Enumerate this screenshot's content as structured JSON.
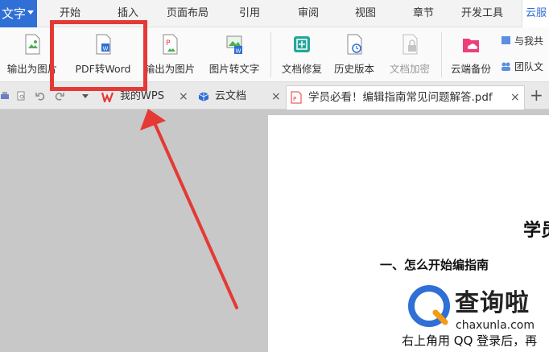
{
  "menubar": {
    "app_label": "文字",
    "tabs": [
      "开始",
      "插入",
      "页面布局",
      "引用",
      "审阅",
      "视图",
      "章节",
      "开发工具",
      "云服"
    ]
  },
  "ribbon": {
    "buttons": [
      "输出为图片",
      "PDF转Word",
      "输出为图片",
      "图片转文字",
      "文档修复",
      "历史版本",
      "文档加密",
      "云端备份"
    ],
    "small_buttons": [
      "与我共",
      "团队文"
    ]
  },
  "tabbar": {
    "tabs": [
      "我的WPS",
      "云文档",
      "学员必看！编辑指南常见问题解答.pdf"
    ],
    "close_symbol": "×",
    "plus_symbol": "+"
  },
  "document": {
    "title": "学员",
    "heading": "一、怎么开始编指南",
    "body": "右上角用 QQ 登录后，再"
  },
  "watermark": {
    "brand": "查询啦",
    "url": "chaxunla.com"
  },
  "colors": {
    "accent": "#2f6fd6",
    "highlight": "#e53935"
  }
}
